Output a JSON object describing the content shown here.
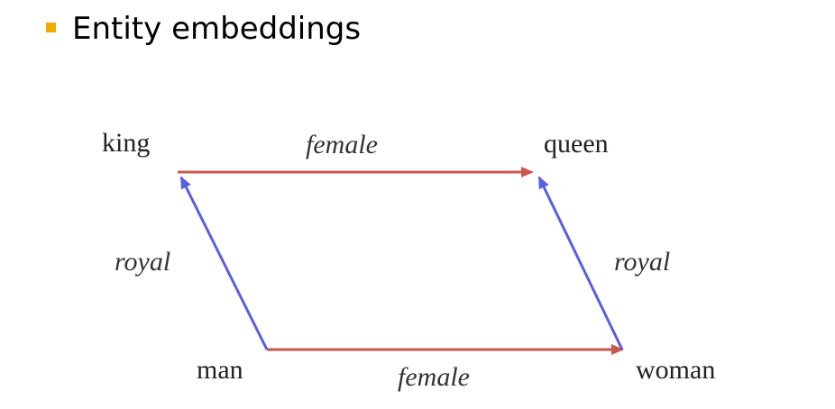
{
  "slide": {
    "title": "Entity embeddings"
  },
  "colors": {
    "bullet": "#f0ad00",
    "female_arrow": "#c8584e",
    "royal_arrow": "#5b5ee0"
  },
  "diagram": {
    "nodes": {
      "king": "king",
      "queen": "queen",
      "man": "man",
      "woman": "woman"
    },
    "edges": {
      "top": "female",
      "bottom": "female",
      "left": "royal",
      "right": "royal"
    }
  }
}
